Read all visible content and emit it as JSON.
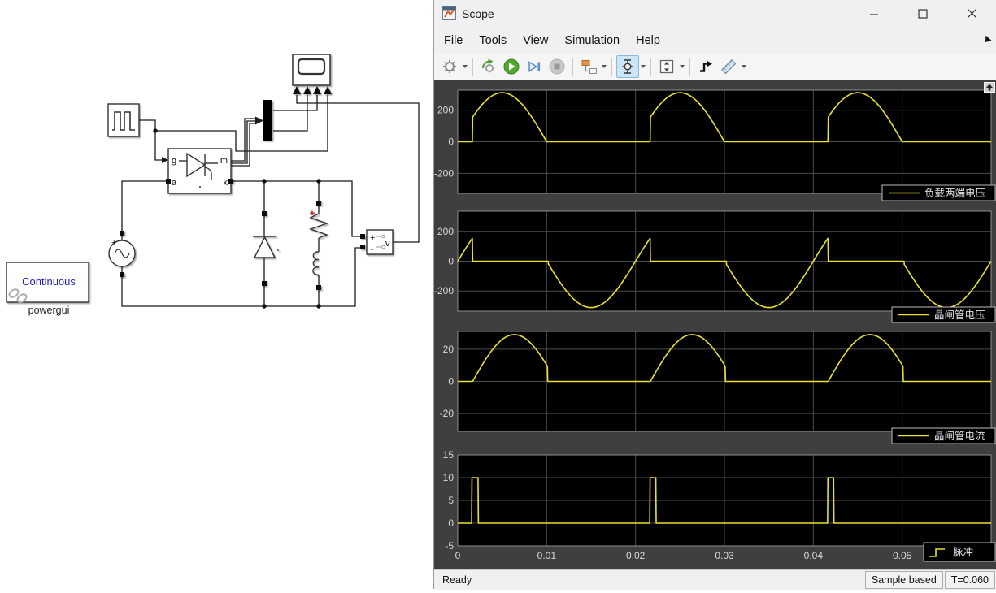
{
  "diagram": {
    "thyristor": {
      "g": "g",
      "a": "a",
      "m": "m",
      "k": "k"
    },
    "powergui": {
      "display": "Continuous",
      "label": "powergui"
    },
    "voltmeter": {
      "plus": "+",
      "minus": "-",
      "output": "v"
    },
    "ac_source": {
      "polarity": "+"
    },
    "rl_branch": {
      "polarity": "+"
    }
  },
  "scope_window": {
    "title": "Scope",
    "menu": [
      "File",
      "Tools",
      "View",
      "Simulation",
      "Help"
    ],
    "toolbar": [
      "configuration-properties",
      "highlight-simulink-block",
      "run",
      "step-forward",
      "stop",
      "signal-selector",
      "cursor-measurements",
      "span-axes",
      "trigger",
      "measurements"
    ],
    "status": {
      "ready": "Ready",
      "sample_mode": "Sample based",
      "sim_time": "T=0.060"
    }
  },
  "colors": {
    "waveform_yellow": "#e9e12c",
    "axes_black": "#000000",
    "grid_gray": "#4c4c4c",
    "figure_background": "#3f3f3f",
    "tick_text": "#d9d9d9",
    "powergui_blue": "#2020c0",
    "branch_plus_red": "#cc1111"
  },
  "chart_data": [
    {
      "type": "line",
      "legend": "负载两端电压",
      "signal": "load_voltage",
      "ylim": [
        -327,
        327
      ],
      "yticks": [
        200,
        0,
        -200
      ],
      "xlim": [
        0,
        0.06
      ],
      "xgrid": [
        0.01,
        0.02,
        0.03,
        0.04,
        0.05
      ],
      "params": {
        "amplitude": 311,
        "frequency_hz": 50,
        "period": 0.02,
        "firing_time": 0.00167
      },
      "description": "Load voltage of half-wave controlled rectifier: 0 until firing at 30 deg, then 311*sin(2*pi*50*t) until source zero-crossing; 3 cycles over 0-0.06 s, peak 311"
    },
    {
      "type": "line",
      "legend": "晶闸管电压",
      "signal": "thyristor_voltage",
      "ylim": [
        -335,
        335
      ],
      "yticks": [
        200,
        0,
        -200
      ],
      "xlim": [
        0,
        0.06
      ],
      "xgrid": [
        0.01,
        0.02,
        0.03,
        0.04,
        0.05
      ],
      "params": {
        "amplitude": 311,
        "frequency_hz": 50,
        "period": 0.02,
        "firing_time": 0.00167
      },
      "description": "Thyristor anode-cathode voltage: follows source while blocking (rises to ~155 before firing, full negative half-cycle to -311), ~0 while conducting"
    },
    {
      "type": "line",
      "legend": "晶闸管电流",
      "signal": "thyristor_current",
      "ylim": [
        -31,
        31
      ],
      "yticks": [
        20,
        0,
        -20
      ],
      "xlim": [
        0,
        0.06
      ],
      "xgrid": [
        0.01,
        0.02,
        0.03,
        0.04,
        0.05
      ],
      "params": {
        "period": 0.02,
        "firing_time": 0.00167,
        "peak": 29,
        "shape_period": 0.0094
      },
      "description": "Thyristor current: zero until firing, rises to ~29 peak, decays to ~9 then cuts off at source zero-crossing; repeats each 0.02 s"
    },
    {
      "type": "line",
      "legend": "脉冲",
      "signal": "gate_pulse",
      "ylim": [
        -5,
        15
      ],
      "yticks": [
        15,
        10,
        5,
        0,
        -5
      ],
      "xlim": [
        0,
        0.06
      ],
      "xgrid": [
        0.01,
        0.02,
        0.03,
        0.04,
        0.05
      ],
      "xticks": [
        0,
        0.01,
        0.02,
        0.03,
        0.04,
        0.05
      ],
      "xtick_labels": [
        "0",
        "0.01",
        "0.02",
        "0.03",
        "0.04",
        "0.05"
      ],
      "params": {
        "amplitude": 10,
        "period": 0.02,
        "pulse_start": 0.0016,
        "pulse_width": 0.0007
      },
      "description": "Gate trigger pulses: amplitude 10, width ~0.7 ms, at t = 0.0016, 0.0216, 0.0416 s"
    }
  ]
}
